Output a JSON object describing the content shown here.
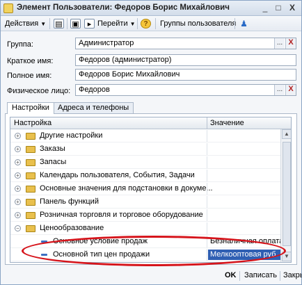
{
  "window": {
    "title": "Элемент Пользователи: Федоров Борис Михайлович"
  },
  "titlebar_buttons": {
    "minimize": "_",
    "maximize": "□",
    "close": "X"
  },
  "toolbar": {
    "actions_label": "Действия",
    "goto_label": "Перейти",
    "help_label": "?",
    "user_groups_label": "Группы пользователя"
  },
  "form": {
    "group": {
      "label": "Группа:",
      "value": "Администратор"
    },
    "short_name": {
      "label": "Краткое имя:",
      "value": "Федоров (администратор)"
    },
    "full_name": {
      "label": "Полное имя:",
      "value": "Федоров Борис Михайлович"
    },
    "physical_person": {
      "label": "Физическое лицо:",
      "value": "Федоров"
    },
    "select_btn": "...",
    "clear_btn": "X"
  },
  "tabs": [
    {
      "label": "Настройки"
    },
    {
      "label": "Адреса и телефоны"
    }
  ],
  "table": {
    "headers": {
      "setting": "Настройка",
      "value": "Значение"
    },
    "rows": [
      {
        "label": "Другие настройки",
        "value": ""
      },
      {
        "label": "Заказы",
        "value": ""
      },
      {
        "label": "Запасы",
        "value": ""
      },
      {
        "label": "Календарь пользователя, События, Задачи",
        "value": ""
      },
      {
        "label": "Основные значения для подстановки в докуме...",
        "value": ""
      },
      {
        "label": "Панель функций",
        "value": ""
      },
      {
        "label": "Розничная торговля и торговое оборудование",
        "value": ""
      },
      {
        "label": "Ценообразование",
        "value": ""
      },
      {
        "label": "Основное условие продаж",
        "value": "Безналичная оплата"
      },
      {
        "label": "Основной тип цен продажи",
        "value": "Мелкооптовая руб."
      }
    ]
  },
  "bottom": {
    "ok": "OK",
    "save": "Записать",
    "close": "Закрыть"
  },
  "colors": {
    "highlight": "#d6141b",
    "selection": "#2f5fb3"
  }
}
